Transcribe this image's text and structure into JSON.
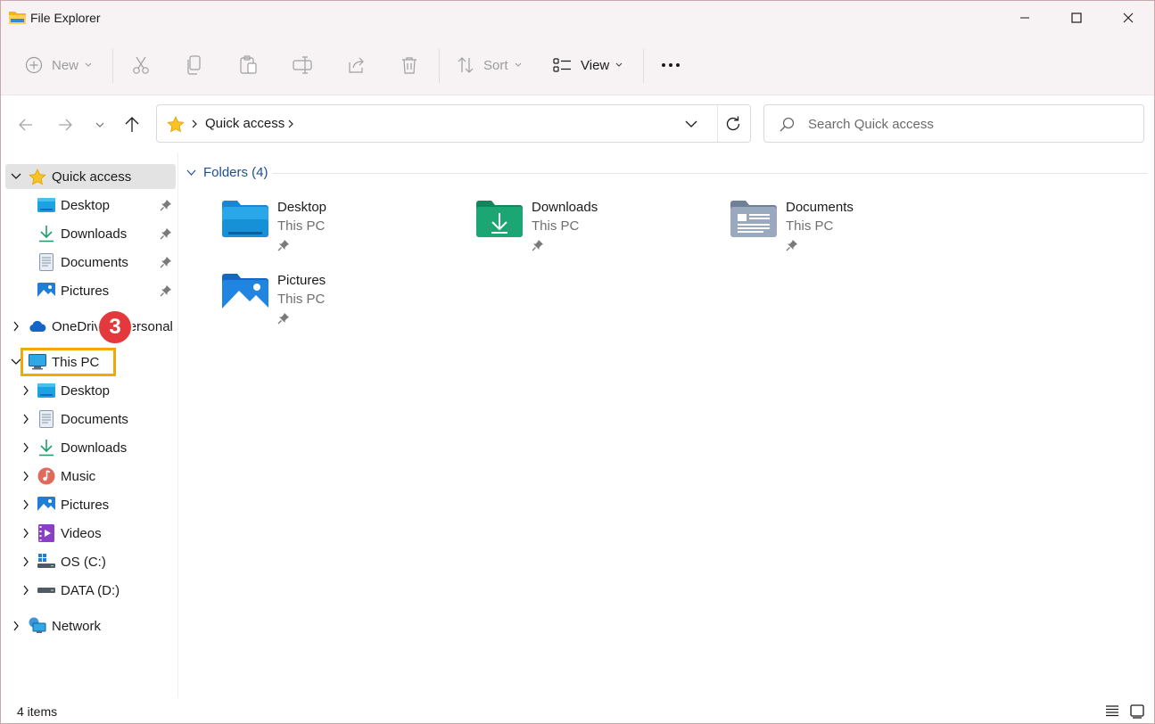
{
  "window": {
    "title": "File Explorer"
  },
  "commands": {
    "new_label": "New",
    "sort_label": "Sort",
    "view_label": "View"
  },
  "address": {
    "crumb": "Quick access"
  },
  "search": {
    "placeholder": "Search Quick access"
  },
  "sidebar": {
    "quick_access": {
      "label": "Quick access",
      "items": [
        {
          "label": "Desktop"
        },
        {
          "label": "Downloads"
        },
        {
          "label": "Documents"
        },
        {
          "label": "Pictures"
        }
      ]
    },
    "onedrive": {
      "label": "OneDrive - Personal"
    },
    "this_pc": {
      "label": "This PC",
      "items": [
        {
          "label": "Desktop"
        },
        {
          "label": "Documents"
        },
        {
          "label": "Downloads"
        },
        {
          "label": "Music"
        },
        {
          "label": "Pictures"
        },
        {
          "label": "Videos"
        },
        {
          "label": "OS (C:)"
        },
        {
          "label": "DATA (D:)"
        }
      ]
    },
    "network": {
      "label": "Network"
    },
    "step_badge": "3"
  },
  "content": {
    "group_label": "Folders (4)",
    "folders": [
      {
        "name": "Desktop",
        "location": "This PC"
      },
      {
        "name": "Downloads",
        "location": "This PC"
      },
      {
        "name": "Documents",
        "location": "This PC"
      },
      {
        "name": "Pictures",
        "location": "This PC"
      }
    ]
  },
  "status": {
    "items": "4 items"
  },
  "colors": {
    "accent_blue": "#1d4f91",
    "highlight": "#f0a80a",
    "badge": "#e4393c",
    "selected_bg": "#e3e3e3"
  }
}
